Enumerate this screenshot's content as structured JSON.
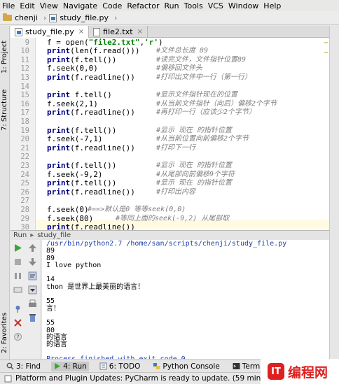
{
  "menu": [
    "File",
    "Edit",
    "View",
    "Navigate",
    "Code",
    "Refactor",
    "Run",
    "Tools",
    "VCS",
    "Window",
    "Help"
  ],
  "breadcrumb": {
    "folder": "chenji",
    "file": "study_file.py"
  },
  "left_tool_tabs": {
    "project": "1: Project",
    "structure": "7: Structure",
    "favorites": "2: Favorites"
  },
  "editor_tabs": [
    {
      "label": "study_file.py",
      "active": true
    },
    {
      "label": "file2.txt",
      "active": false
    }
  ],
  "code_lines": [
    {
      "n": "9",
      "code": "f = open(\"file2.txt\",'r')",
      "comment": ""
    },
    {
      "n": "10",
      "code": "print(len(f.read()))",
      "comment": "#文件总长度 89"
    },
    {
      "n": "11",
      "code": "print(f.tell())",
      "comment": "#读完文件，文件指针位置89"
    },
    {
      "n": "12",
      "code": "f.seek(0,0)",
      "comment": "#偏移回文件头"
    },
    {
      "n": "13",
      "code": "print(f.readline())",
      "comment": "#打印出文件中一行（第一行）"
    },
    {
      "n": "14",
      "code": "",
      "comment": ""
    },
    {
      "n": "15",
      "code": "print f.tell()",
      "comment": "#显示文件指针现在的位置"
    },
    {
      "n": "16",
      "code": "f.seek(2,1)",
      "comment": "#从当前文件指针（向后）偏移2个字节"
    },
    {
      "n": "17",
      "code": "print(f.readline())",
      "comment": "#再打印一行（应该少2个字节）"
    },
    {
      "n": "18",
      "code": "",
      "comment": ""
    },
    {
      "n": "19",
      "code": "print(f.tell())",
      "comment": "#显示 现在 的指针位置"
    },
    {
      "n": "20",
      "code": "f.seek(-7,1)",
      "comment": "#从当前位置向前偏移2个字节"
    },
    {
      "n": "21",
      "code": "print(f.readline())",
      "comment": "#打印下一行"
    },
    {
      "n": "22",
      "code": "",
      "comment": ""
    },
    {
      "n": "23",
      "code": "print(f.tell())",
      "comment": "#显示 现在 的指针位置"
    },
    {
      "n": "24",
      "code": "f.seek(-9,2)",
      "comment": "#从尾部向前偏移9个字符"
    },
    {
      "n": "25",
      "code": "print(f.tell())",
      "comment": "#显示 现在 的指针位置"
    },
    {
      "n": "26",
      "code": "print(f.readline())",
      "comment": "#打印出内容"
    },
    {
      "n": "27",
      "code": "",
      "comment": ""
    },
    {
      "n": "28",
      "code": "f.seek(0)",
      "comment": "#==>默认是0 等等seek(0,0)"
    },
    {
      "n": "29",
      "code": "f.seek(80)",
      "comment": "#等同上面的seek(-9,2) 从尾部取"
    },
    {
      "n": "30",
      "code": "print(f.readline())",
      "comment": ""
    }
  ],
  "run_panel": {
    "header": "Run",
    "config": "study_file",
    "console": [
      "/usr/bin/python2.7 /home/san/scripts/chenji/study_file.py",
      "89",
      "89",
      "I love python",
      "",
      "14",
      "thon 是世界上最美丽的语言！",
      "",
      "55",
      "言！",
      "",
      "55",
      "80",
      "的语言",
      "的语言",
      "",
      "Process finished with exit code 0"
    ]
  },
  "bottom_tabs": [
    "3: Find",
    "4: Run",
    "6: TODO",
    "Python Console",
    "Terminal"
  ],
  "status": "Platform and Plugin Updates: PyCharm is ready to update. (59 minutes ago)",
  "watermark": {
    "logo_text": "IT",
    "text": "编程网"
  },
  "colors": {
    "keyword": "#000080",
    "string": "#008000",
    "comment": "#7f7f7f",
    "run_green": "#3aa63a",
    "watermark_red": "#e02020"
  }
}
